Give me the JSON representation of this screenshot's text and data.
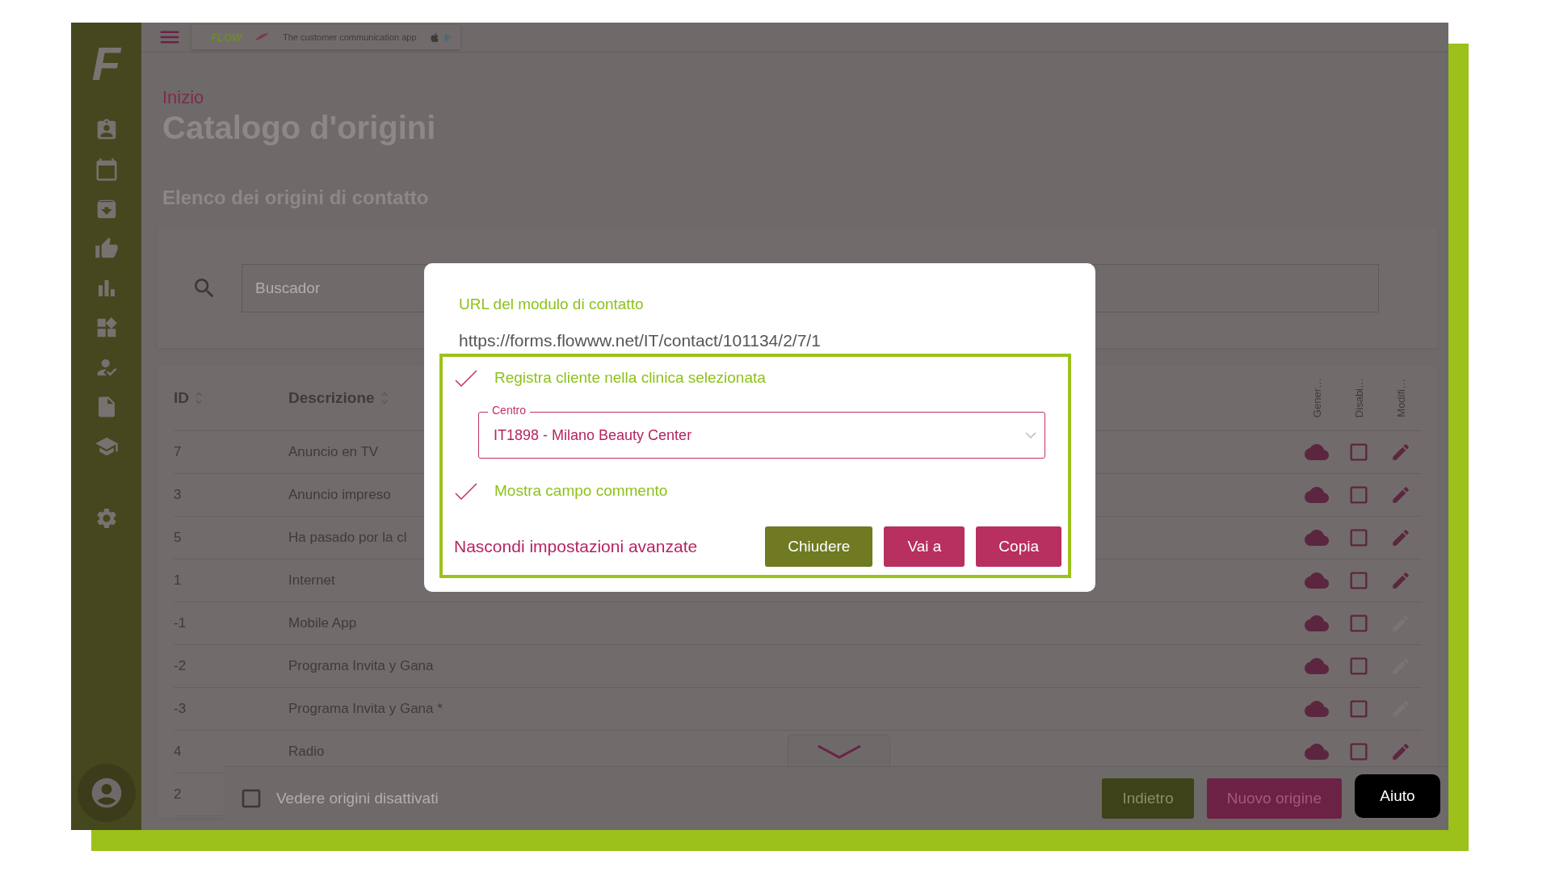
{
  "sidebar": {
    "logo": "F"
  },
  "top_bar": {
    "banner": {
      "logo": "FLOW",
      "tagline": "The customer communication app"
    }
  },
  "breadcrumb": "Inizio",
  "title": "Catalogo d'origini",
  "section_title": "Elenco dei origini di contatto",
  "search": {
    "placeholder": "Buscador"
  },
  "table": {
    "columns": [
      {
        "label": "ID",
        "kind": "sortable"
      },
      {
        "label": "Descrizione",
        "kind": "sortable"
      },
      {
        "label": "Gener…",
        "kind": "vertical"
      },
      {
        "label": "Disabi…",
        "kind": "vertical"
      },
      {
        "label": "Modifi…",
        "kind": "vertical"
      }
    ],
    "rows": [
      {
        "id": "7",
        "description": "Anuncio en TV",
        "disabled": false,
        "editable": true
      },
      {
        "id": "3",
        "description": "Anuncio impreso",
        "disabled": false,
        "editable": true
      },
      {
        "id": "5",
        "description": "Ha pasado por la cl",
        "disabled": false,
        "editable": true
      },
      {
        "id": "1",
        "description": "Internet",
        "disabled": false,
        "editable": true
      },
      {
        "id": "-1",
        "description": "Mobile App",
        "disabled": false,
        "editable": false
      },
      {
        "id": "-2",
        "description": "Programa Invita y Gana",
        "disabled": false,
        "editable": false
      },
      {
        "id": "-3",
        "description": "Programa Invita y Gana *",
        "disabled": false,
        "editable": false
      },
      {
        "id": "4",
        "description": "Radio",
        "disabled": false,
        "editable": true
      },
      {
        "id": "2"
      }
    ]
  },
  "footer": {
    "show_disabled": {
      "label": "Vedere origini disattivati",
      "checked": false
    },
    "buttons": [
      {
        "label": "Indietro",
        "kind": "secondary"
      },
      {
        "label": "Nuovo origine",
        "kind": "primary"
      }
    ],
    "help": "Aiuto"
  },
  "modal": {
    "label": "URL del modulo di contatto",
    "url": "https://forms.flowww.net/IT/contact/101134/2/7/1",
    "options": [
      {
        "label": "Registra cliente nella clinica selezionata",
        "checked": true
      },
      {
        "label": "Mostra campo commento",
        "checked": true
      }
    ],
    "select": {
      "legend": "Centro",
      "value": "IT1898 - Milano Beauty Center"
    },
    "link": "Nascondi impostazioni avanzate",
    "buttons": [
      {
        "label": "Chiudere",
        "kind": "secondary"
      },
      {
        "label": "Vai a",
        "kind": "primary"
      },
      {
        "label": "Copia",
        "kind": "primary"
      }
    ]
  }
}
